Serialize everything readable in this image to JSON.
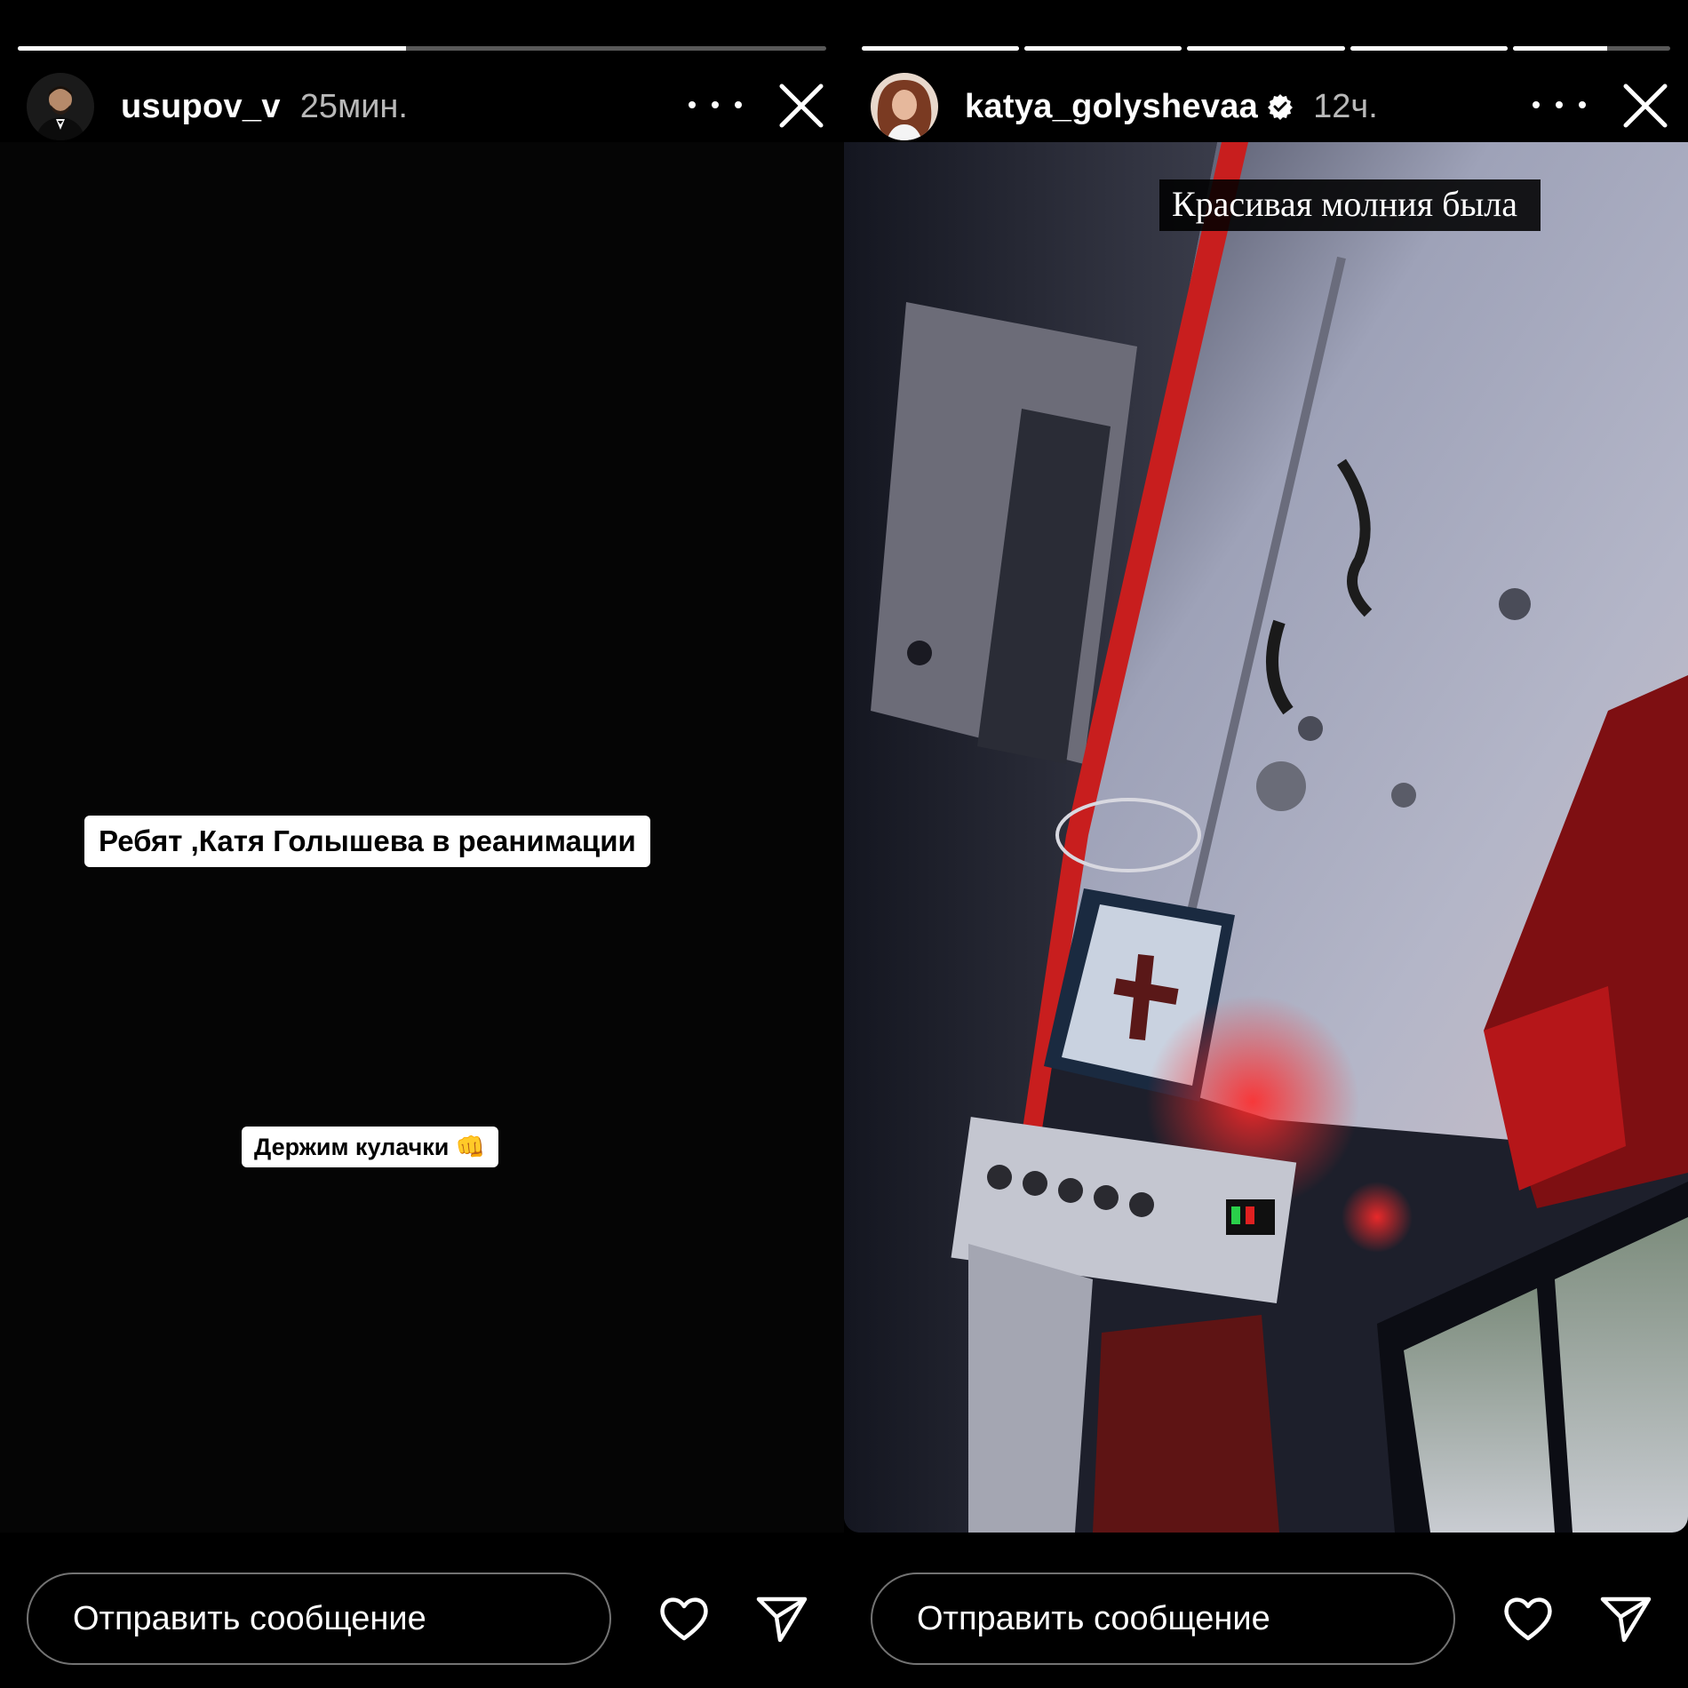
{
  "stories": [
    {
      "username": "usupov_v",
      "time": "25мин.",
      "progress": [
        0.48
      ],
      "stickers": {
        "main": "Ребят ,Катя  Голышева в реанимации",
        "secondary": "Держим кулачки",
        "secondary_emoji": "👊"
      },
      "reply_placeholder": "Отправить сообщение"
    },
    {
      "username": "katya_golyshevaa",
      "verified": true,
      "time": "12ч.",
      "progress": [
        1,
        1,
        1,
        1,
        0.6
      ],
      "caption": "Красивая молния была",
      "reply_placeholder": "Отправить сообщение"
    }
  ],
  "colors": {
    "background": "#000000",
    "ambulance_red": "#c81e1e",
    "ceiling": "#8e93a8"
  },
  "icons": [
    "more-icon",
    "close-icon",
    "heart-icon",
    "send-icon",
    "verified-icon"
  ]
}
